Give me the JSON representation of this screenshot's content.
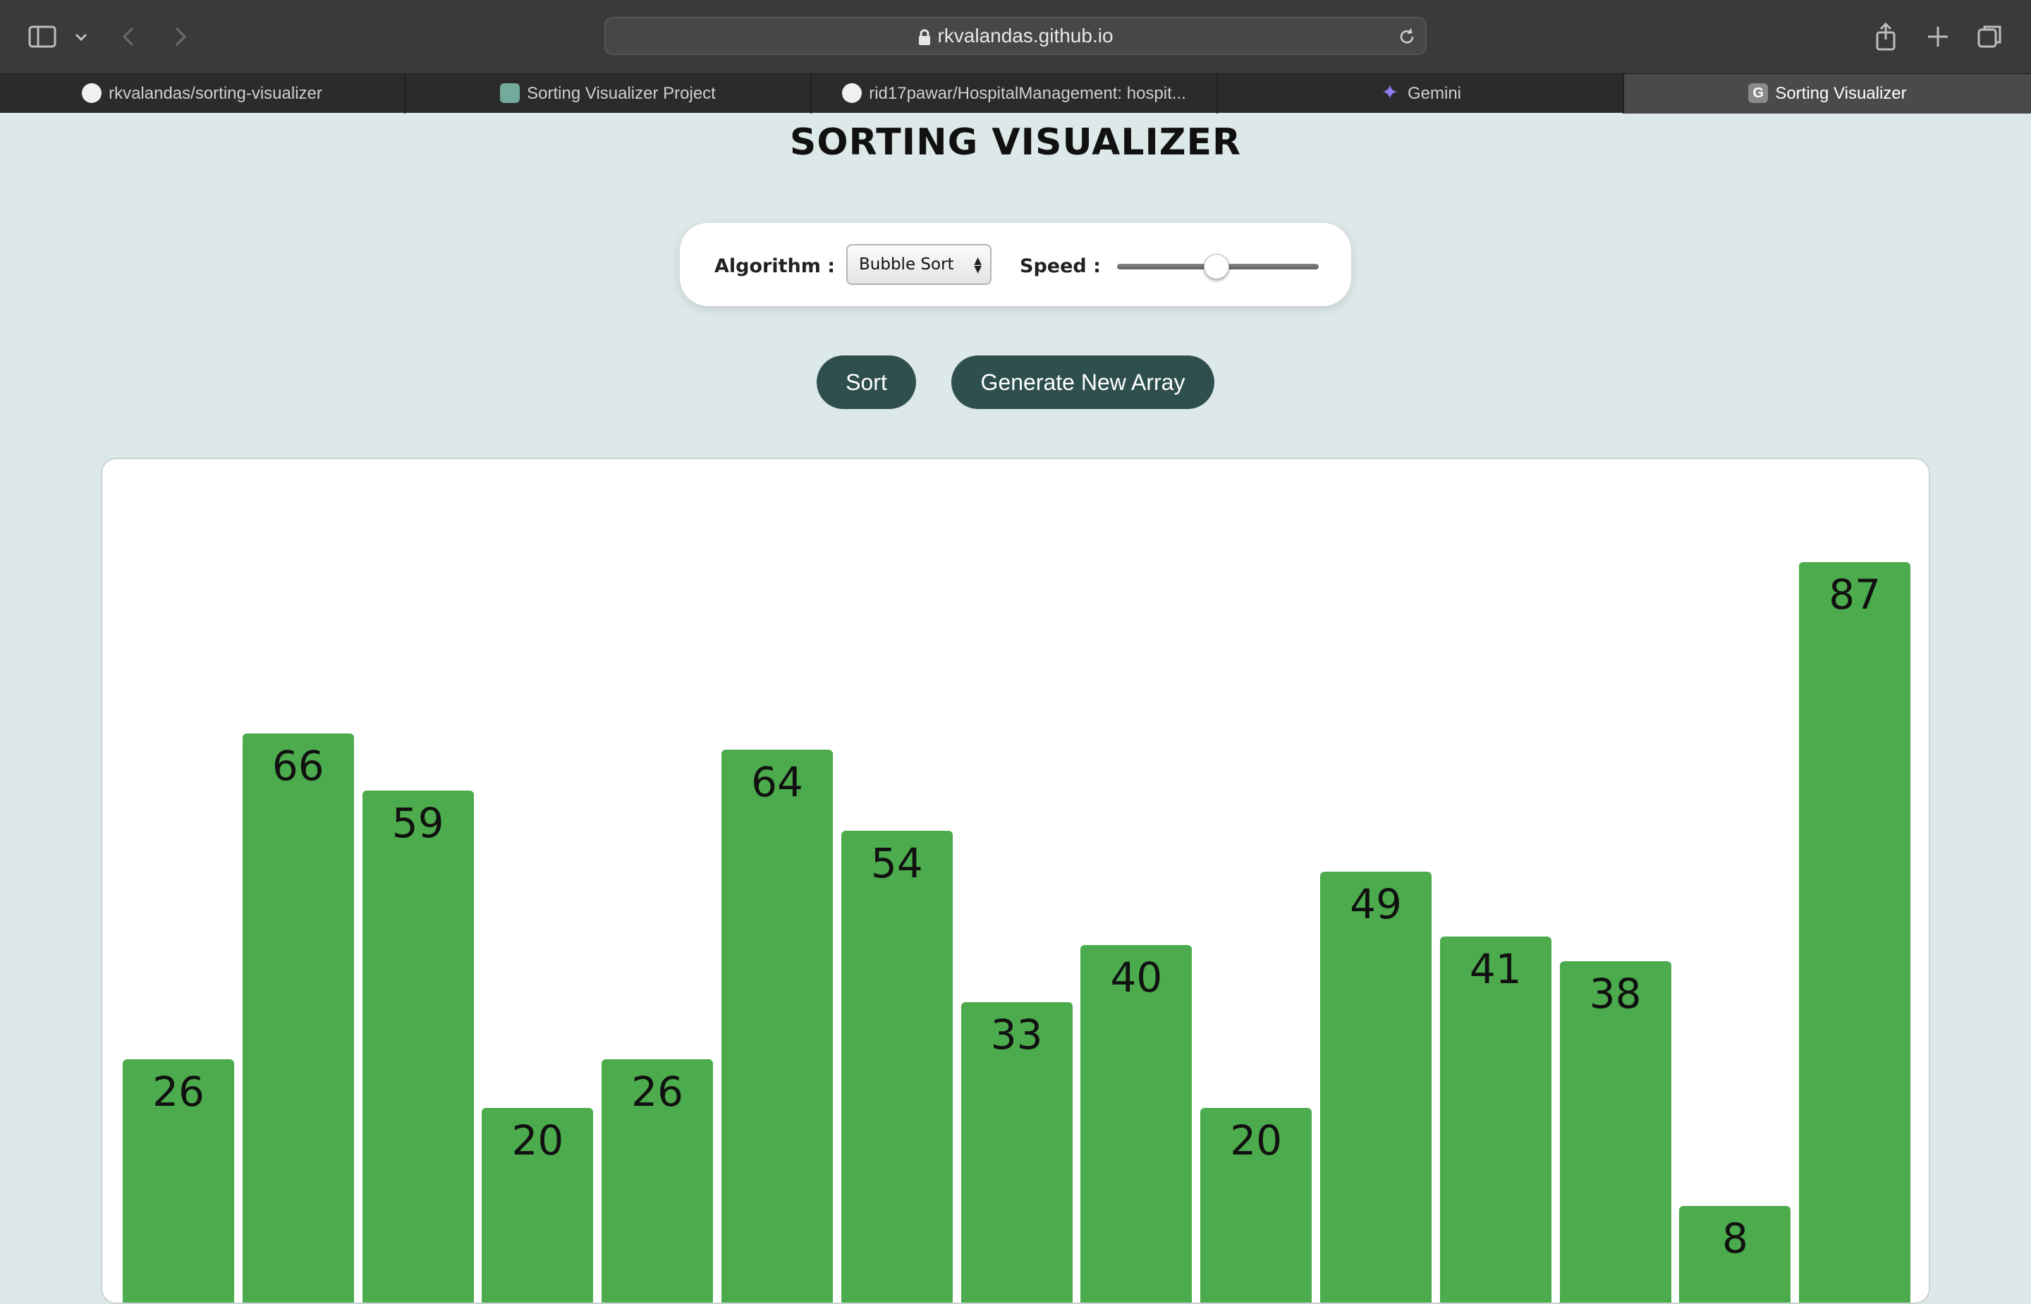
{
  "browser": {
    "url": "rkvalandas.github.io",
    "tabs": [
      {
        "label": "rkvalandas/sorting-visualizer",
        "icon": "github-icon"
      },
      {
        "label": "Sorting Visualizer Project",
        "icon": "chatgpt-icon"
      },
      {
        "label": "rid17pawar/HospitalManagement: hospit...",
        "icon": "github-icon"
      },
      {
        "label": "Gemini",
        "icon": "gemini-icon"
      },
      {
        "label": "Sorting Visualizer",
        "icon": "g-icon",
        "favicon_letter": "G",
        "active": true
      }
    ]
  },
  "page": {
    "title": "SORTING VISUALIZER",
    "algorithm_label": "Algorithm :",
    "algorithm_selected": "Bubble Sort",
    "speed_label": "Speed :",
    "speed_value_fraction": 0.49,
    "sort_button": "Sort",
    "generate_button": "Generate New Array"
  },
  "colors": {
    "background": "#dde8e8",
    "button": "#2f4f4f",
    "bar": "#4cab4c"
  },
  "chart_data": {
    "type": "bar",
    "values": [
      26,
      66,
      59,
      20,
      26,
      64,
      54,
      33,
      40,
      20,
      49,
      41,
      38,
      8,
      87
    ]
  }
}
